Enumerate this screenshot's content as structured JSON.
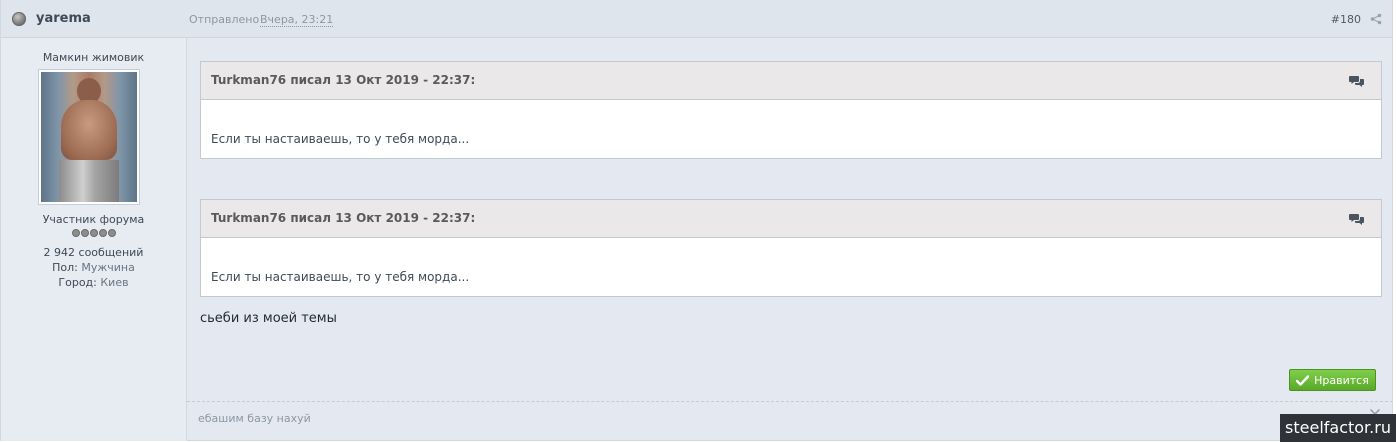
{
  "post": {
    "author": "yarema",
    "sent_label": "Отправлено",
    "sent_date": "Вчера, 23:21",
    "number": "#180"
  },
  "author_panel": {
    "title": "Мамкин жимовик",
    "group": "Участник форума",
    "rating_pips": 5,
    "posts_count": "2 942 сообщений",
    "gender_label": "Пол:",
    "gender_value": "Мужчина",
    "city_label": "Город:",
    "city_value": "Киев"
  },
  "quotes": [
    {
      "citation": "Turkman76 писал 13 Окт 2019 - 22:37:",
      "text": "Если ты настаиваешь, то у тебя морда..."
    },
    {
      "citation": "Turkman76 писал 13 Окт 2019 - 22:37:",
      "text": "Если ты настаиваешь, то у тебя морда..."
    }
  ],
  "body_text": "сьеби из моей темы",
  "like_button_label": "Нравится",
  "signature": "ебашим базу нахуй",
  "watermark": "steelfactor.ru",
  "colors": {
    "accent_green": "#5aa92a",
    "header_bg": "#dfe5ec",
    "quote_head_bg": "#eae8e8"
  }
}
